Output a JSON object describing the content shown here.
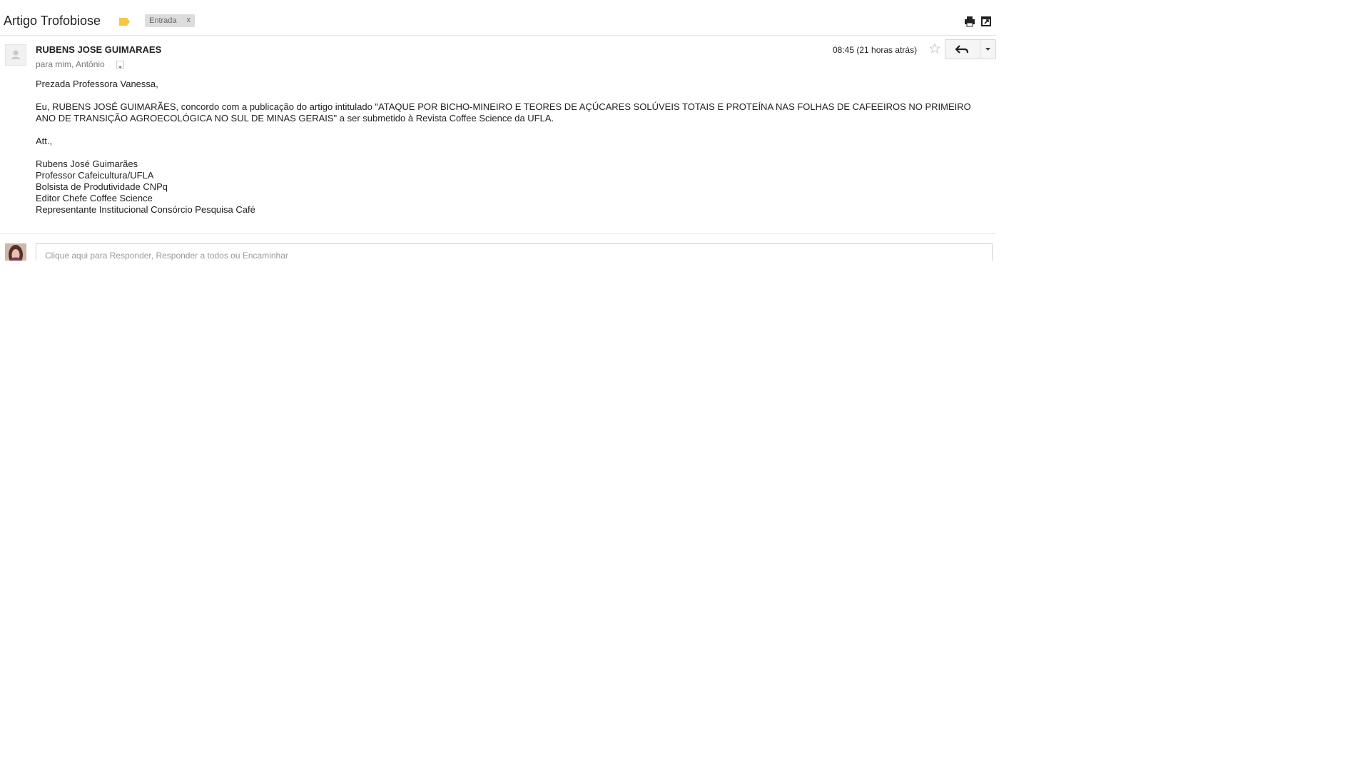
{
  "header": {
    "subject": "Artigo Trofobiose",
    "label_chip": "Entrada",
    "chip_close": "x",
    "icons": [
      "label-icon",
      "print-icon",
      "new-window-icon"
    ]
  },
  "message": {
    "sender": "RUBENS JOSE GUIMARAES",
    "recipients": "para mim, Antônio",
    "time": "08:45 (21 horas atrás)",
    "body": {
      "greeting": "Prezada Professora Vanessa,",
      "paragraph": "Eu, RUBENS JOSÉ GUIMARÃES, concordo com a publicação do artigo intitulado \"ATAQUE POR BICHO-MINEIRO E TEORES DE AÇÚCARES SOLÚVEIS TOTAIS E PROTEÍNA NAS FOLHAS DE CAFEEIROS NO PRIMEIRO ANO DE TRANSIÇÃO AGROECOLÓGICA NO SUL DE MINAS GERAIS\"  a ser submetido à Revista Coffee Science da UFLA.",
      "closing": "Att.,",
      "signature": [
        "Rubens José Guimarães",
        "Professor Cafeicultura/UFLA",
        "Bolsista de Produtividade CNPq",
        "Editor Chefe Coffee Science",
        "Representante Institucional Consórcio Pesquisa Café"
      ]
    }
  },
  "reply": {
    "placeholder": "Clique aqui para Responder, Responder a todos ou Encaminhar"
  },
  "colors": {
    "label_yellow": "#f6c744",
    "chip_bg": "#dddddd",
    "muted_text": "#777777"
  }
}
